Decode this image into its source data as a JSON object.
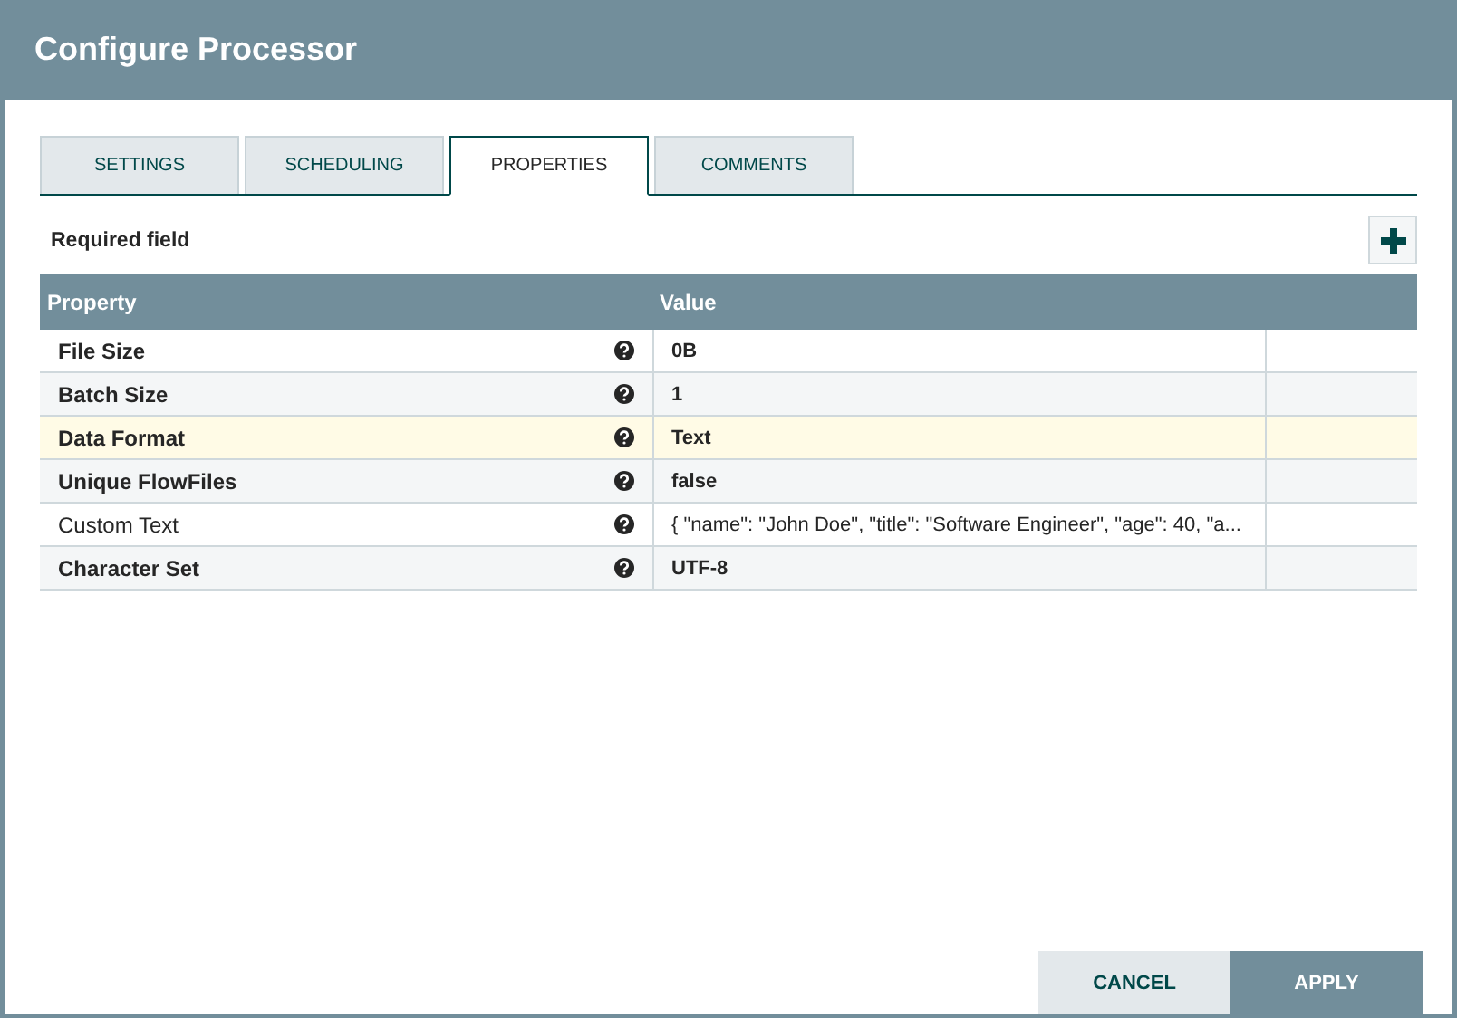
{
  "window": {
    "title": "Configure Processor"
  },
  "tabs": [
    {
      "label": "SETTINGS",
      "selected": false
    },
    {
      "label": "SCHEDULING",
      "selected": false
    },
    {
      "label": "PROPERTIES",
      "selected": true
    },
    {
      "label": "COMMENTS",
      "selected": false
    }
  ],
  "required_note": "Required field",
  "table": {
    "columns": [
      "Property",
      "Value"
    ],
    "rows": [
      {
        "property": "File Size",
        "value": "0B",
        "required": true,
        "selected": false
      },
      {
        "property": "Batch Size",
        "value": "1",
        "required": true,
        "selected": false
      },
      {
        "property": "Data Format",
        "value": "Text",
        "required": true,
        "selected": true
      },
      {
        "property": "Unique FlowFiles",
        "value": "false",
        "required": true,
        "selected": false
      },
      {
        "property": "Custom Text",
        "value": "{ \"name\": \"John Doe\", \"title\": \"Software Engineer\", \"age\": 40, \"a...",
        "required": false,
        "selected": false
      },
      {
        "property": "Character Set",
        "value": "UTF-8",
        "required": true,
        "selected": false
      }
    ]
  },
  "buttons": [
    {
      "label": "CANCEL",
      "kind": "secondary"
    },
    {
      "label": "APPLY",
      "kind": "primary"
    }
  ]
}
